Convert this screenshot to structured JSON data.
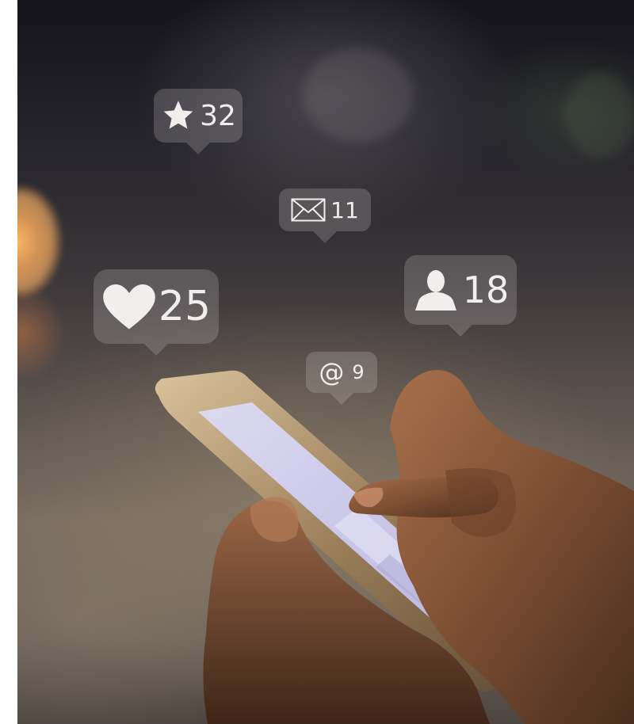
{
  "notifications": [
    {
      "icon": "star-icon",
      "count": "32"
    },
    {
      "icon": "envelope-icon",
      "count": "11"
    },
    {
      "icon": "heart-icon",
      "count": "25"
    },
    {
      "icon": "person-icon",
      "count": "18"
    },
    {
      "icon": "at-sign-icon",
      "count": "9"
    }
  ],
  "at_symbol": "@",
  "colors": {
    "bubble": "#d7d2d2",
    "bokeh_light": "#ffb058",
    "background_dark": "#14141a",
    "skin": "#8a5a3c",
    "phone_frame": "#b89a70",
    "screen": "#c9c6e6"
  }
}
